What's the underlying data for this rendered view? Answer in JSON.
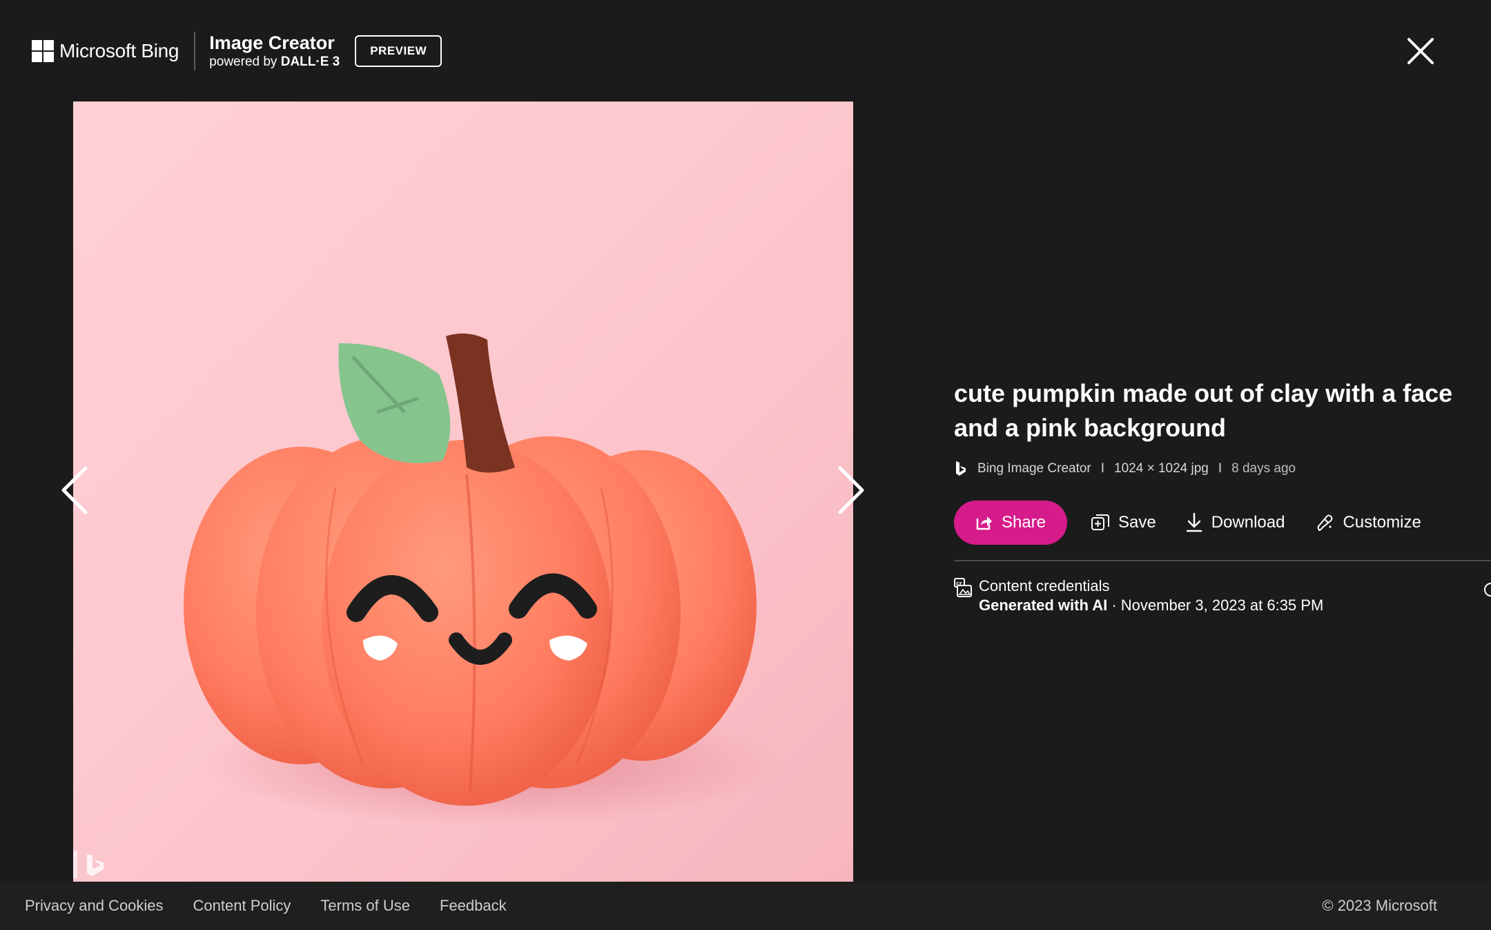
{
  "header": {
    "brand": "Microsoft Bing",
    "product_title": "Image Creator",
    "product_sub_prefix": "powered by ",
    "product_sub_model": "DALL·E 3",
    "preview_label": "PREVIEW"
  },
  "image": {
    "alt": "cute pumpkin made out of clay with a face and a pink background"
  },
  "details": {
    "prompt": "cute pumpkin made out of clay with a face and a pink background",
    "source": "Bing Image Creator",
    "separator": "I",
    "dimensions": "1024 × 1024 jpg",
    "age": "8 days ago"
  },
  "actions": {
    "share": "Share",
    "save": "Save",
    "download": "Download",
    "customize": "Customize"
  },
  "credentials": {
    "title": "Content credentials",
    "generated": "Generated with AI",
    "separator": " · ",
    "date": "November 3, 2023 at 6:35 PM"
  },
  "footer": {
    "links": [
      "Privacy and Cookies",
      "Content Policy",
      "Terms of Use",
      "Feedback"
    ],
    "copyright": "© 2023 Microsoft"
  },
  "colors": {
    "background": "#1b1b1b",
    "accent": "#d61b8a",
    "image_bg": "#ffc9cf",
    "pumpkin": "#ff7e62"
  },
  "icons": {
    "close": "close-icon",
    "prev": "chevron-left-icon",
    "next": "chevron-right-icon",
    "share": "share-icon",
    "save": "save-collection-icon",
    "download": "download-icon",
    "customize": "customize-brush-icon",
    "credentials": "content-credentials-icon"
  }
}
